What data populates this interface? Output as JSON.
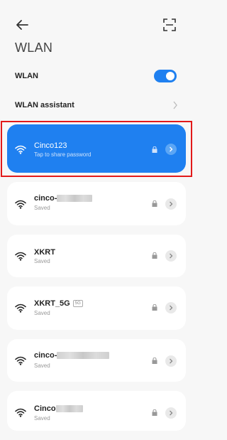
{
  "header": {
    "title": "WLAN"
  },
  "settings": {
    "wlan_label": "WLAN",
    "wlan_on": true,
    "assistant_label": "WLAN assistant"
  },
  "networks": [
    {
      "name": "Cinco123",
      "status": "Tap to share password",
      "active": true
    },
    {
      "name": "cinco-",
      "status": "Saved",
      "masked": true
    },
    {
      "name": "XKRT",
      "status": "Saved"
    },
    {
      "name": "XKRT_5G",
      "badge": "5G",
      "status": "Saved"
    },
    {
      "name": "cinco-",
      "status": "Saved",
      "masked": true
    },
    {
      "name": "Cinco",
      "status": "Saved",
      "masked": true
    }
  ],
  "colors": {
    "accent": "#1f80f0",
    "highlight": "#e21a1a"
  },
  "icons": [
    "back-arrow-icon",
    "scan-icon",
    "wifi-icon",
    "lock-icon",
    "chevron-right-icon"
  ]
}
